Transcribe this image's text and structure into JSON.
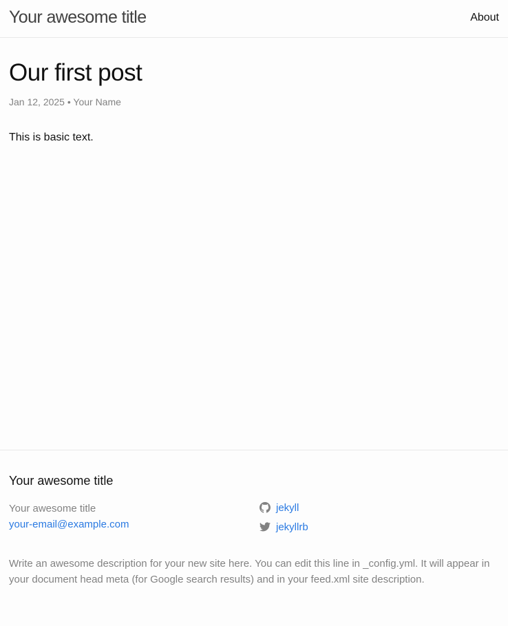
{
  "header": {
    "site_title": "Your awesome title",
    "nav": [
      {
        "label": "About"
      }
    ]
  },
  "post": {
    "title": "Our first post",
    "meta": "Jan 12, 2025 • Your Name",
    "body": "This is basic text."
  },
  "footer": {
    "heading": "Your awesome title",
    "name": "Your awesome title",
    "email": "your-email@example.com",
    "social": [
      {
        "icon": "github-icon",
        "label": "jekyll"
      },
      {
        "icon": "twitter-icon",
        "label": "jekyllrb"
      }
    ],
    "description": "Write an awesome description for your new site here. You can edit this line in _config.yml. It will appear in your document head meta (for Google search results) and in your feed.xml site description."
  },
  "colors": {
    "background": "#fdfdfd",
    "text": "#111111",
    "muted": "#828282",
    "link": "#2a7ae2",
    "border": "#e8e8e8"
  }
}
